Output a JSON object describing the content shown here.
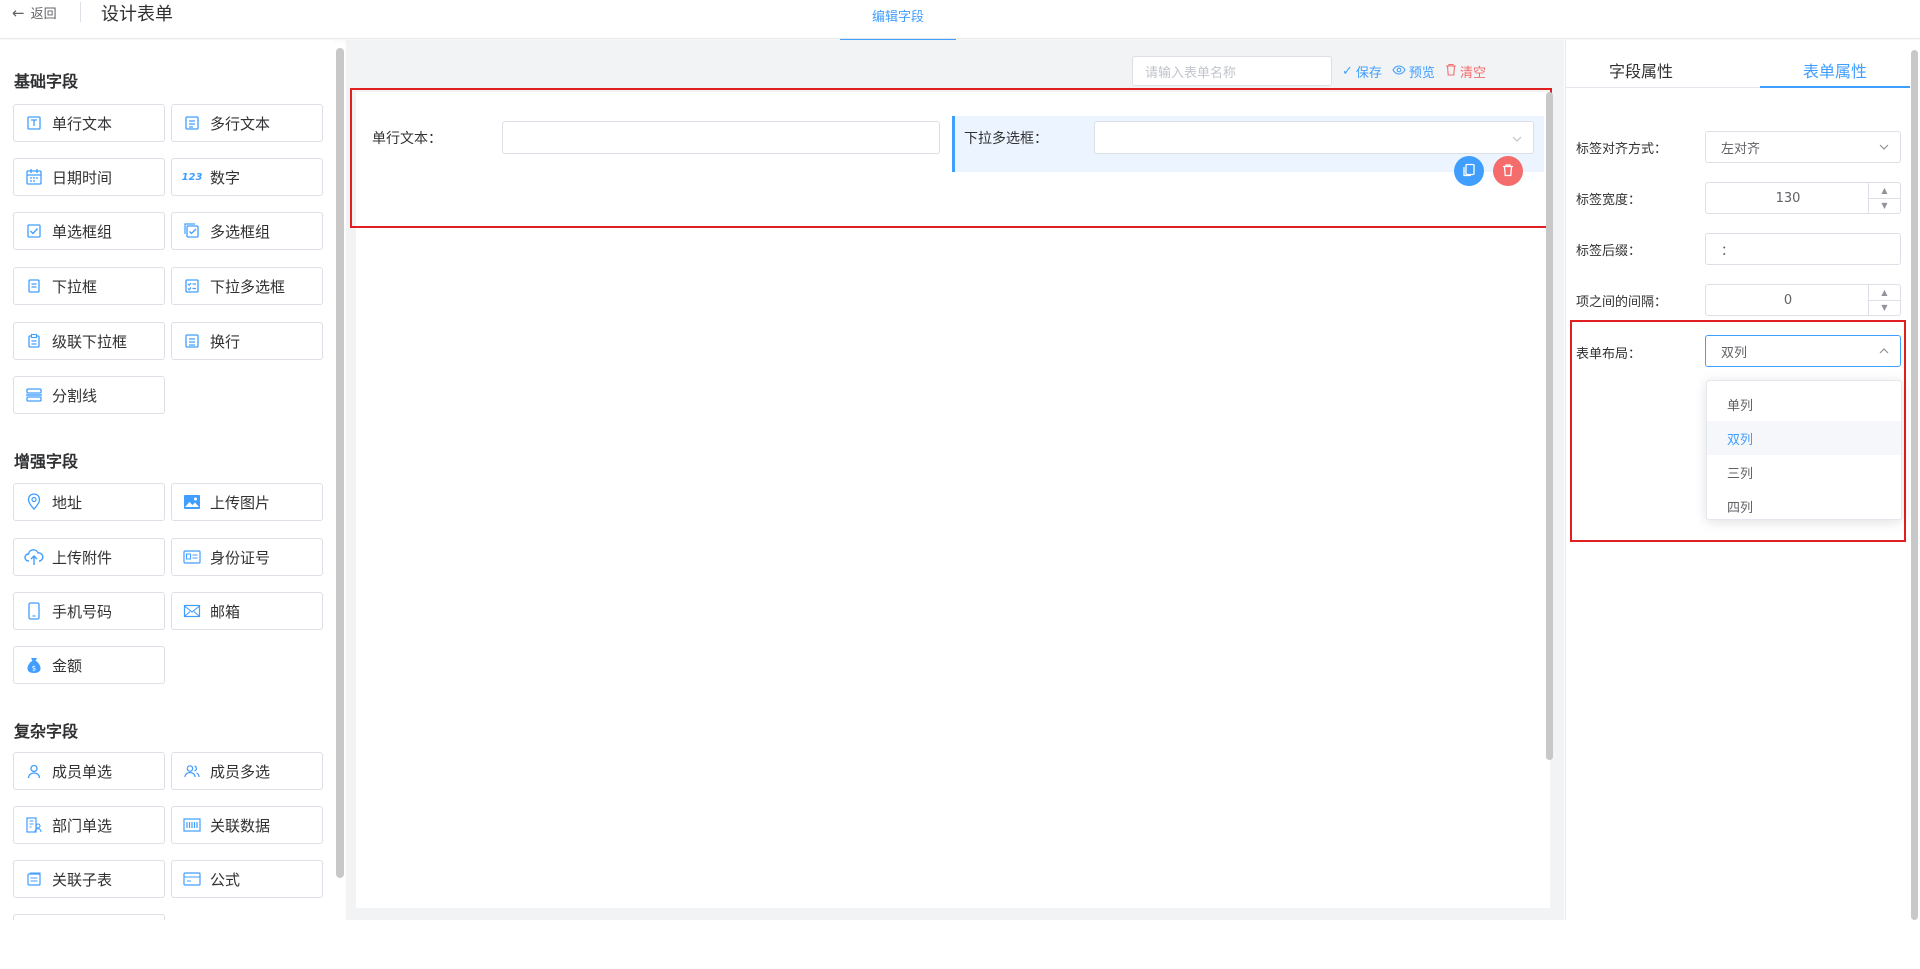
{
  "header": {
    "back_label": "返回",
    "title": "设计表单",
    "tab_label": "编辑字段"
  },
  "groups": {
    "basic": "基础字段",
    "enhanced": "增强字段",
    "complex": "复杂字段"
  },
  "basic_fields": [
    "单行文本",
    "多行文本",
    "日期时间",
    "数字",
    "单选框组",
    "多选框组",
    "下拉框",
    "下拉多选框",
    "级联下拉框",
    "换行",
    "分割线"
  ],
  "enhanced_fields": [
    "地址",
    "上传图片",
    "上传附件",
    "身份证号",
    "手机号码",
    "邮箱",
    "金额"
  ],
  "complex_fields": [
    "成员单选",
    "成员多选",
    "部门单选",
    "关联数据",
    "关联子表",
    "公式"
  ],
  "toolbar": {
    "name_placeholder": "请输入表单名称",
    "save": "保存",
    "preview": "预览",
    "clear": "清空"
  },
  "canvas": {
    "field1_label": "单行文本：",
    "field2_label": "下拉多选框："
  },
  "right_tabs": {
    "field_props": "字段属性",
    "form_props": "表单属性"
  },
  "props": {
    "label_align_label": "标签对齐方式：",
    "label_align_value": "左对齐",
    "label_width_label": "标签宽度：",
    "label_width_value": "130",
    "label_suffix_label": "标签后缀：",
    "label_suffix_value": "：",
    "item_gap_label": "项之间的间隔：",
    "item_gap_value": "0",
    "layout_label": "表单布局：",
    "layout_value": "双列"
  },
  "layout_options": [
    "单列",
    "双列",
    "三列",
    "四列"
  ],
  "colors": {
    "accent": "#409eff",
    "danger": "#f56c6c",
    "highlight_box": "#e02020"
  }
}
